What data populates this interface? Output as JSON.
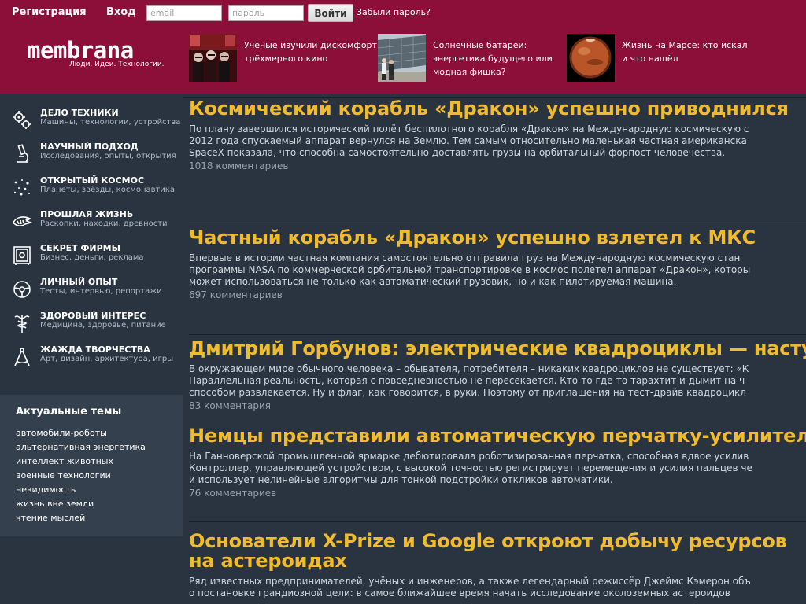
{
  "login_bar": {
    "register_label": "Регистрация",
    "login_label": "Вход",
    "email_placeholder": "email",
    "password_placeholder": "пароль",
    "submit_label": "Войти",
    "forgot_label": "Забыли пароль?"
  },
  "brand": {
    "name": "membrana",
    "tagline": "Люди. Идеи. Технологии."
  },
  "teasers": [
    {
      "text": "Учёные изучили дискомфорт трёхмерного кино",
      "image": "cinema-audience-3d-glasses"
    },
    {
      "text": "Солнечные батареи: энергетика будущего или модная фишка?",
      "image": "solar-panels-field"
    },
    {
      "text": "Жизнь на Марсе: кто искал и что нашёл",
      "image": "planet-mars"
    }
  ],
  "categories": [
    {
      "title": "ДЕЛО ТЕХНИКИ",
      "subtitle": "Машины, технологии, устройства",
      "icon": "gears-icon"
    },
    {
      "title": "НАУЧНЫЙ ПОДХОД",
      "subtitle": "Исследования, опыты, открытия",
      "icon": "microscope-icon"
    },
    {
      "title": "ОТКРЫТЫЙ КОСМОС",
      "subtitle": "Планеты, звёзды, космонавтика",
      "icon": "stars-icon"
    },
    {
      "title": "ПРОШЛАЯ ЖИЗНЬ",
      "subtitle": "Раскопки, находки, древности",
      "icon": "fossil-icon"
    },
    {
      "title": "СЕКРЕТ ФИРМЫ",
      "subtitle": "Бизнес, деньги, реклама",
      "icon": "safe-icon"
    },
    {
      "title": "ЛИЧНЫЙ ОПЫТ",
      "subtitle": "Тесты, интервью, репортажи",
      "icon": "steering-wheel-icon"
    },
    {
      "title": "ЗДОРОВЫЙ ИНТЕРЕС",
      "subtitle": "Медицина, здоровье, питание",
      "icon": "caduceus-icon"
    },
    {
      "title": "ЖАЖДА ТВОРЧЕСТВА",
      "subtitle": "Арт, дизайн, архитектура, игры",
      "icon": "compass-icon"
    }
  ],
  "topics": {
    "title": "Актуальные темы",
    "items": [
      "автомобили-роботы",
      "альтернативная энергетика",
      "интеллект животных",
      "военные технологии",
      "невидимость",
      "жизнь вне земли",
      "чтение мыслей"
    ]
  },
  "articles": [
    {
      "title": "Космический корабль «Дракон» успешно приводнился",
      "body": [
        "По плану завершился исторический полёт беспилотного корабля «Дракон» на Международную космическую с",
        "2012 года спускаемый аппарат вернулся на Землю. Тем самым относительно маленькая частная американска",
        "SpaceX показала, что способна самостоятельно доставлять грузы на орбитальный форпост человечества."
      ],
      "comments": "1018 комментариев"
    },
    {
      "title": "Частный корабль «Дракон» успешно взлетел к МКС",
      "body": [
        "Впервые в истории частная компания самостоятельно отправила груз на Международную космическую стан",
        "программы NASA по коммерческой орбитальной транспортировке в космос полетел аппарат «Дракон», которы",
        "может использоваться не только как автоматический грузовик, но и как пилотируемая машина."
      ],
      "comments": "697 комментариев"
    },
    {
      "title": "Дмитрий Горбунов: электрические квадроциклы — наступ",
      "body": [
        "В окружающем мире обычного человека – обывателя, потребителя – никаких квадроциклов не существует: «К",
        "Параллельная реальность, которая с повседневностью не пересекается. Кто-то где-то тарахтит и дымит на ч",
        "способом развлекается. Ну и флаг, как говорится, в руки. Поэтому от приглашения на тест-драйв квадроцикл"
      ],
      "comments": "83 комментария"
    },
    {
      "title": "Немцы представили автоматическую перчатку-усилитель",
      "body": [
        "На Ганноверской промышленной ярмарке дебютировала роботизированная перчатка, способная вдвое усилив",
        "Контроллер, управляющей устройством, с высокой точностью регистрирует перемещения и усилия пальцев че",
        "и использует нелинейные алгоритмы для тонкой подстройки откликов автоматики."
      ],
      "comments": "76 комментариев"
    },
    {
      "title": "Основатели X-Prize и Google откроют добычу ресурсов на астероидах",
      "body": [
        "Ряд известных предпринимателей, учёных и инженеров, а также легендарный режиссёр Джеймс Кэмерон объ",
        "о постановке грандиозной цели: в самое ближайшее время начать исследование околоземных астероидов"
      ],
      "comments": ""
    }
  ],
  "colors": {
    "header_bg": "#8c0f3a",
    "page_bg": "#2a3441",
    "topics_bg": "#34404e",
    "headline": "#f0bb2c"
  }
}
